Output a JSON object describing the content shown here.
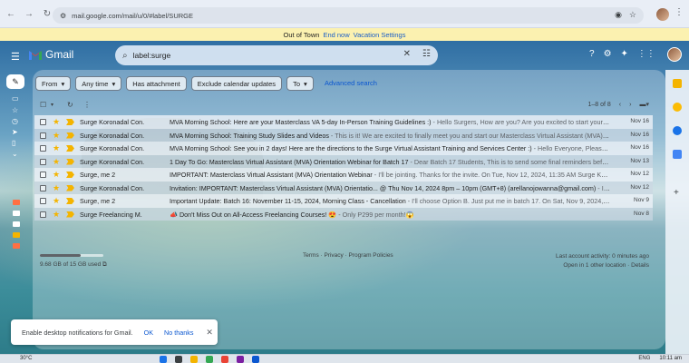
{
  "browser": {
    "url": "mail.google.com/mail/u/0/#label/SURGE"
  },
  "banner": {
    "text": "Out of Town",
    "end_now": "End now",
    "settings": "Vacation Settings"
  },
  "app": {
    "name": "Gmail"
  },
  "search": {
    "value": "label:surge"
  },
  "filters": {
    "from": "From",
    "any_time": "Any time",
    "has_attachment": "Has attachment",
    "exclude_calendar": "Exclude calendar updates",
    "to": "To",
    "advanced_search": "Advanced search"
  },
  "pager": {
    "range": "1–8 of 8"
  },
  "emails": [
    {
      "sender": "Surge Koronadal Con.",
      "subject": "MVA Morning School: Here are your Masterclass VA 5-day In-Person Training Guidelines :)",
      "snippet": " - Hello Surgers, How are you? Are you excited to start your trai...",
      "date": "Nov 16"
    },
    {
      "sender": "Surge Koronadal Con.",
      "subject": "MVA Morning School: Training Study Slides and Videos",
      "snippet": " - This is it! We are excited to finally meet you and start our Masterclass Virtual Assistant (MVA) 5-...",
      "date": "Nov 16"
    },
    {
      "sender": "Surge Koronadal Con.",
      "subject": "MVA Morning School: See you in 2 days! Here are the directions to the Surge Virtual Assistant Training and Services Center :)",
      "snippet": " - Hello Everyone, Please cre...",
      "date": "Nov 16"
    },
    {
      "sender": "Surge Koronadal Con.",
      "subject": "1 Day To Go: Masterclass Virtual Assistant (MVA) Orientation Webinar for Batch 17",
      "snippet": " - Dear Batch 17 Students, This is to send some final reminders before o...",
      "date": "Nov 13"
    },
    {
      "sender": "Surge, me 2",
      "subject": "IMPORTANT: Masterclass Virtual Assistant (MVA) Orientation Webinar",
      "snippet": " - I'll be jointing. Thanks for the invite. On Tue, Nov 12, 2024, 11:35 AM Surge Koronad...",
      "date": "Nov 12"
    },
    {
      "sender": "Surge Koronadal Con.",
      "subject": "Invitation: IMPORTANT: Masterclass Virtual Assistant (MVA) Orientatio... @ Thu Nov 14, 2024 8pm – 10pm (GMT+8) (arellanojowanna@gmail.com)",
      "snippet": " - IMPO...",
      "date": "Nov 12"
    },
    {
      "sender": "Surge, me 2",
      "subject": "Important Update: Batch 16: November 11-15, 2024, Morning Class - Cancellation",
      "snippet": " - I'll choose Option B. Just put me in batch 17. On Sat, Nov 9, 2024, 8:00...",
      "date": "Nov 9"
    },
    {
      "sender": "Surge Freelancing M.",
      "subject": "📣 Don't Miss Out on All-Access Freelancing Courses! 😍",
      "snippet": " - Only P299 per month!😱",
      "date": "Nov 8"
    }
  ],
  "storage": {
    "text": "9.68 GB of 15 GB used",
    "fraction": 0.645
  },
  "footer": {
    "links": "Terms · Privacy · Program Policies",
    "activity": "Last account activity: 0 minutes ago",
    "open_in": "Open in 1 other location · Details"
  },
  "snackbar": {
    "message": "Enable desktop notifications for Gmail.",
    "ok": "OK",
    "no_thanks": "No thanks"
  },
  "taskbar": {
    "weather": "30°C",
    "lang": "ENG",
    "time": "10:11 am"
  }
}
